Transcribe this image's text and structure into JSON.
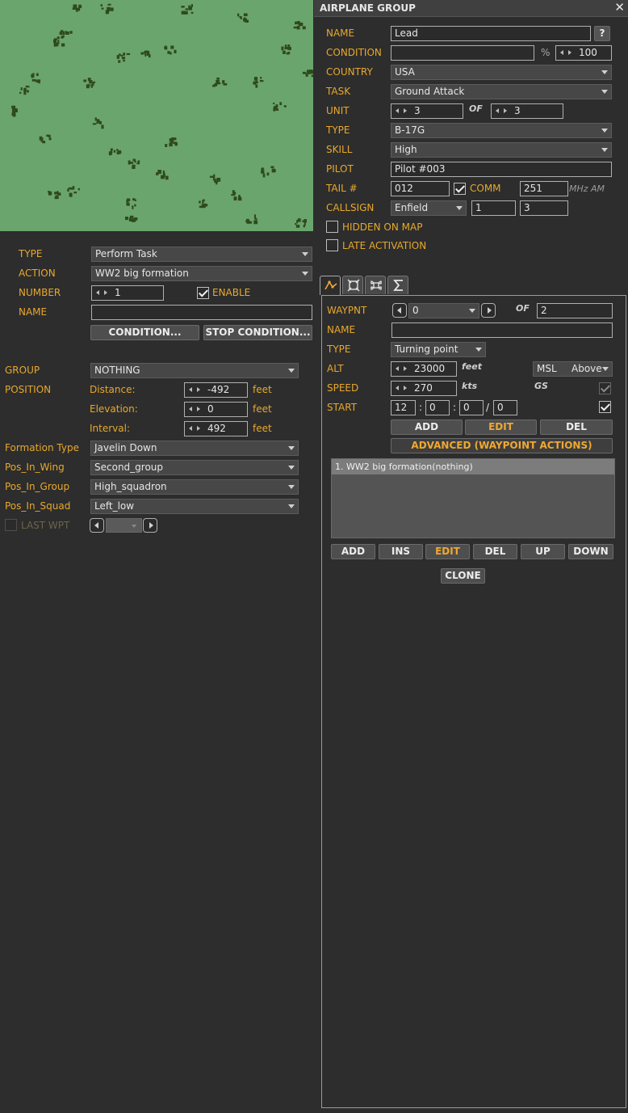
{
  "window": {
    "title": "AIRPLANE GROUP"
  },
  "group": {
    "name_label": "NAME",
    "name_value": "Lead",
    "help_label": "?",
    "condition_label": "CONDITION",
    "condition_value": "",
    "percent_sign": "%",
    "percent_value": "100",
    "country_label": "COUNTRY",
    "country_value": "USA",
    "task_label": "TASK",
    "task_value": "Ground Attack",
    "unit_label": "UNIT",
    "unit_value": "3",
    "of_label": "OF",
    "unit_total": "3",
    "type_label": "TYPE",
    "type_value": "B-17G",
    "skill_label": "SKILL",
    "skill_value": "High",
    "pilot_label": "PILOT",
    "pilot_value": "Pilot #003",
    "tail_label": "TAIL #",
    "tail_value": "012",
    "comm_label": "COMM",
    "comm_checked": true,
    "comm_value": "251",
    "comm_unit": "MHz AM",
    "callsign_label": "CALLSIGN",
    "callsign_value": "Enfield",
    "callsign_num1": "1",
    "callsign_num2": "3",
    "hidden_label": "HIDDEN ON MAP",
    "hidden_checked": false,
    "late_label": "LATE ACTIVATION",
    "late_checked": false
  },
  "tabs": [
    {
      "name": "route",
      "icon": "route-icon",
      "active": true
    },
    {
      "name": "targets",
      "icon": "target-icon",
      "active": false
    },
    {
      "name": "payload",
      "icon": "payload-icon",
      "active": false
    },
    {
      "name": "summary",
      "icon": "sigma-icon",
      "active": false
    }
  ],
  "waypoint": {
    "waypnt_label": "WAYPNT",
    "waypnt_value": "0",
    "of_label": "OF",
    "waypnt_total": "2",
    "name_label": "NAME",
    "name_value": "",
    "type_label": "TYPE",
    "type_value": "Turning point",
    "alt_label": "ALT",
    "alt_value": "23000",
    "alt_unit": "feet",
    "alt_ref": "MSL",
    "alt_mode": "Above",
    "speed_label": "SPEED",
    "speed_value": "270",
    "speed_unit": "kts",
    "gs_label": "GS",
    "start_label": "START",
    "start_h": "12",
    "start_m": "0",
    "start_s": "0",
    "start_d": "0",
    "sep_colon": ":",
    "sep_slash": "/",
    "add_label": "ADD",
    "edit_label": "EDIT",
    "del_label": "DEL",
    "advanced_label": "ADVANCED (WAYPOINT ACTIONS)"
  },
  "actions": {
    "items": [
      "1. WW2 big formation(nothing)"
    ],
    "add_label": "ADD",
    "ins_label": "INS",
    "edit_label": "EDIT",
    "del_label": "DEL",
    "up_label": "UP",
    "down_label": "DOWN",
    "clone_label": "CLONE"
  },
  "task_panel": {
    "type_label": "TYPE",
    "type_value": "Perform Task",
    "action_label": "ACTION",
    "action_value": "WW2 big formation",
    "number_label": "NUMBER",
    "number_value": "1",
    "enable_label": "ENABLE",
    "enable_checked": true,
    "name_label": "NAME",
    "name_value": "",
    "condition_btn": "CONDITION...",
    "stop_condition_btn": "STOP CONDITION..."
  },
  "formation": {
    "group_label": "GROUP",
    "group_value": "NOTHING",
    "position_label": "POSITION",
    "distance_label": "Distance:",
    "distance_value": "-492",
    "distance_unit": "feet",
    "elevation_label": "Elevation:",
    "elevation_value": "0",
    "elevation_unit": "feet",
    "interval_label": "Interval:",
    "interval_value": "492",
    "interval_unit": "feet",
    "ftype_label": "Formation Type",
    "ftype_value": "Javelin Down",
    "wing_label": "Pos_In_Wing",
    "wing_value": "Second_group",
    "pgroup_label": "Pos_In_Group",
    "pgroup_value": "High_squadron",
    "squad_label": "Pos_In_Squad",
    "squad_value": "Left_low",
    "lastwpt_label": "LAST WPT"
  },
  "colors": {
    "accent": "#e8a82c",
    "map_ground": "#6aa56d",
    "map_trees": "#2f4a1c",
    "panel": "#2d2d2d"
  }
}
